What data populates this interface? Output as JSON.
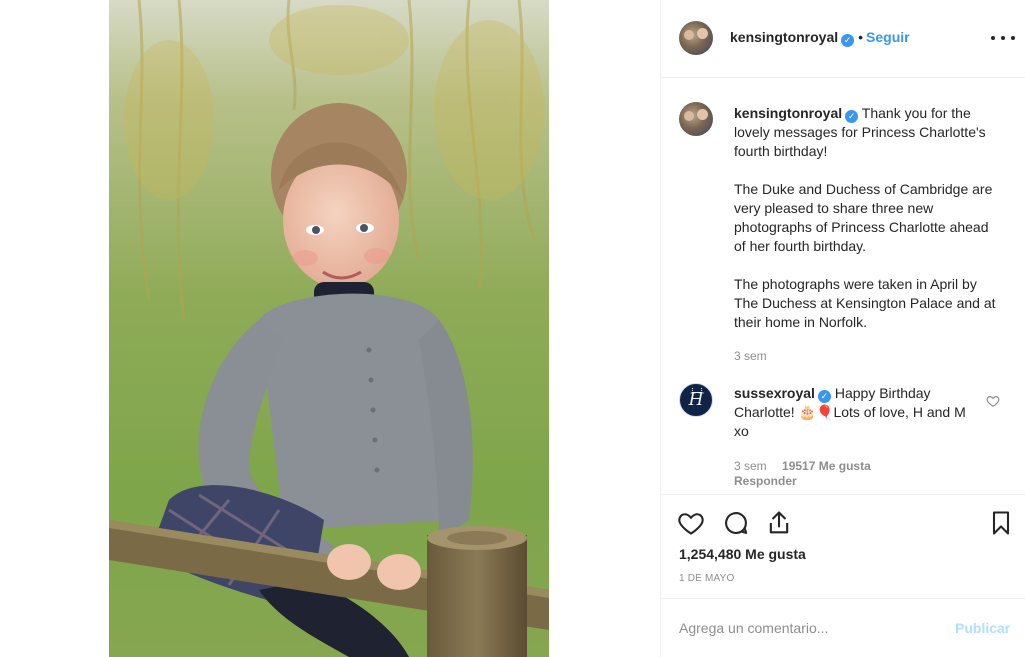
{
  "post": {
    "author": "kensingtonroyal",
    "follow_label": "Seguir",
    "dot": "•"
  },
  "caption": {
    "username": "kensingtonroyal",
    "lines": [
      "Thank you for the lovely messages for Princess Charlotte's fourth birthday!",
      "The Duke and Duchess of Cambridge are very pleased to share three new photographs of Princess Charlotte ahead of her fourth birthday.",
      "The photographs were taken in April by The Duchess at Kensington Palace and at their home in Norfolk."
    ],
    "time": "3 sem"
  },
  "comments": [
    {
      "username": "sussexroyal",
      "text": "Happy Birthday Charlotte! 🎂🎈Lots of love, H and M xo",
      "time": "3 sem",
      "likes": "19517 Me gusta",
      "reply_label": "Responder"
    }
  ],
  "stats": {
    "likes": "1,254,480 Me gusta",
    "date": "1 DE MAYO"
  },
  "composer": {
    "placeholder": "Agrega un comentario...",
    "publish_label": "Publicar"
  },
  "colors": {
    "link_blue": "#3897f0",
    "publish_disabled": "#b2dffc",
    "muted": "#8e8e8e",
    "border": "#efefef"
  },
  "icons": [
    "verified-badge-icon",
    "more-options-icon",
    "heart-icon",
    "comment-icon",
    "share-icon",
    "bookmark-icon"
  ]
}
